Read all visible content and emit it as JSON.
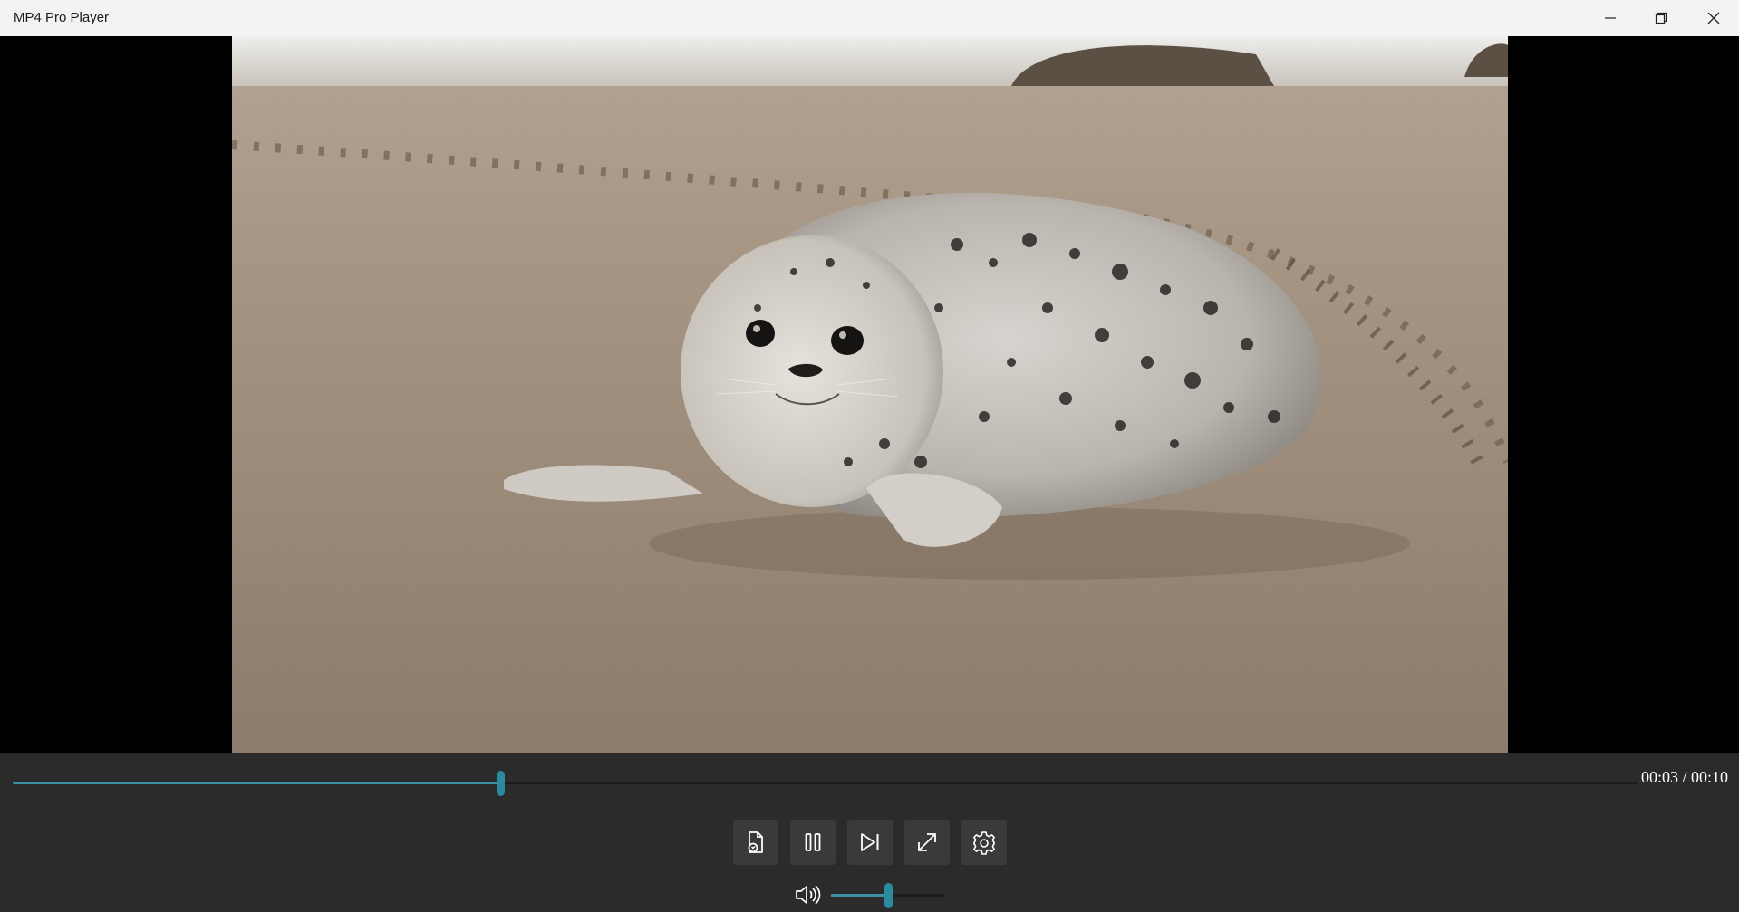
{
  "window": {
    "title": "MP4 Pro Player"
  },
  "titlebar_buttons": {
    "minimize_icon": "minimize-icon",
    "restore_icon": "restore-icon",
    "close_icon": "close-icon"
  },
  "video": {
    "subject": "harbor-seal-pup-on-beach-frame"
  },
  "playback": {
    "time_readout": "00:03 / 00:10",
    "progress_fraction": 0.3
  },
  "controls": {
    "buttons": [
      {
        "name": "open-file-button",
        "icon": "open-file-icon"
      },
      {
        "name": "pause-button",
        "icon": "pause-icon"
      },
      {
        "name": "next-button",
        "icon": "skip-next-icon"
      },
      {
        "name": "fullscreen-button",
        "icon": "fullscreen-icon"
      },
      {
        "name": "settings-button",
        "icon": "gear-icon"
      }
    ]
  },
  "volume": {
    "icon": "speaker-icon",
    "level_fraction": 0.5
  },
  "colors": {
    "accent": "#2a8aa0",
    "controls_bg": "#2b2b2b",
    "titlebar_bg": "#f3f3f3"
  }
}
